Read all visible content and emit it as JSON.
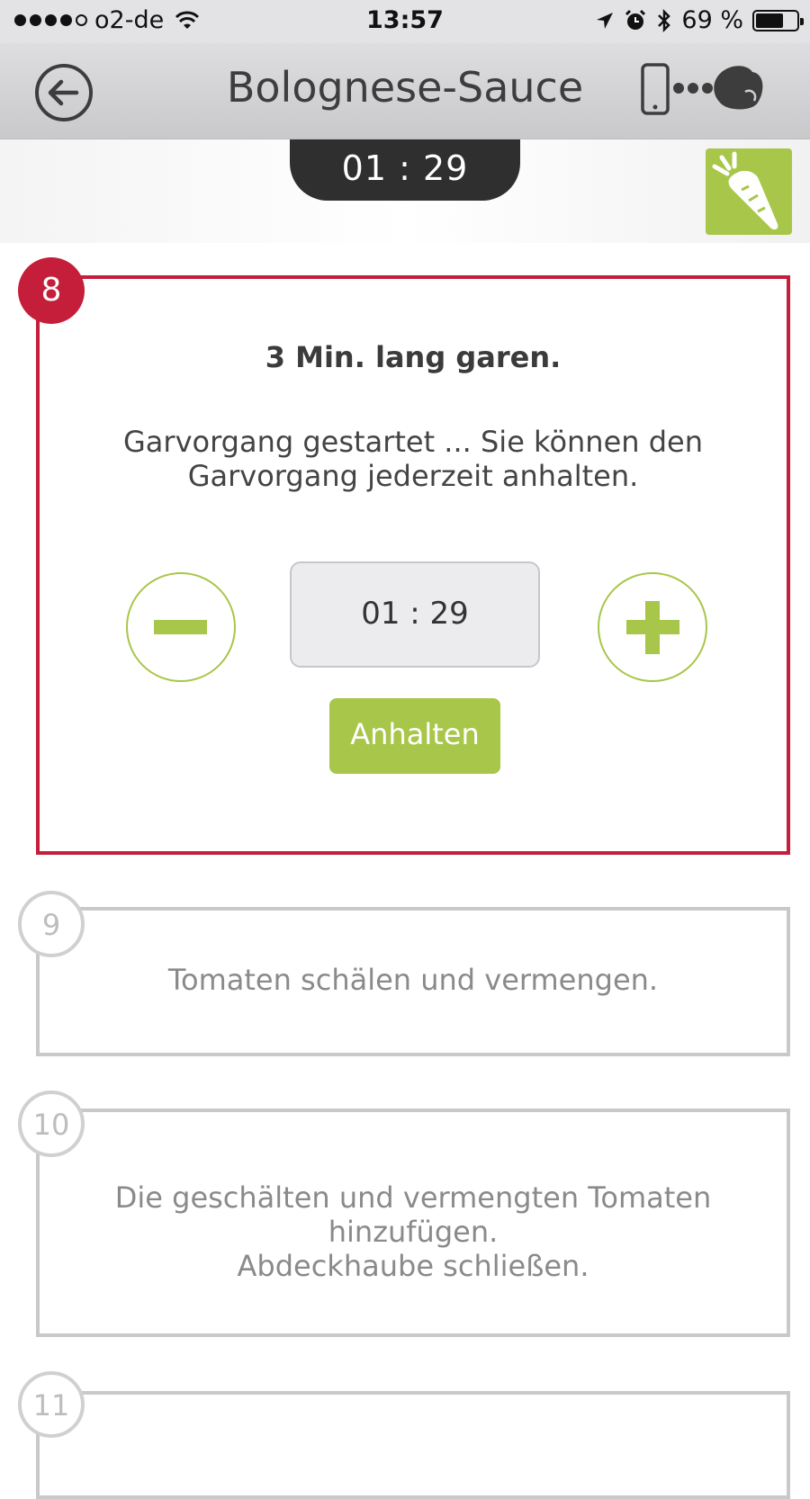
{
  "status_bar": {
    "carrier": "o2-de",
    "time": "13:57",
    "battery": "69 %",
    "battery_level": 0.69,
    "signal_bars_filled": 4,
    "signal_bars_total": 5
  },
  "header": {
    "title": "Bolognese-Sauce",
    "back_icon": "back-arrow-icon",
    "device_icon": "phone-to-cooker-connection-icon"
  },
  "timer": {
    "remaining": "01 : 29",
    "veg_icon": "carrot-icon"
  },
  "steps": [
    {
      "number": "8",
      "heading": "3 Min. lang garen.",
      "text": "Garvorgang gestartet ... Sie können den Garvorgang jederzeit anhalten.",
      "time_value": "01 : 29",
      "stop_label": "Anhalten",
      "active": true
    },
    {
      "number": "9",
      "text": "Tomaten schälen und vermengen.",
      "active": false
    },
    {
      "number": "10",
      "text": "Die geschälten und vermengten Tomaten hinzufügen.\nAbdeckhaube schließen.",
      "active": false
    },
    {
      "number": "11",
      "text": "",
      "active": false
    }
  ],
  "colors": {
    "accent_green": "#a8c64a",
    "active_red": "#c41e3a",
    "inactive_gray": "#c9c9c9"
  }
}
